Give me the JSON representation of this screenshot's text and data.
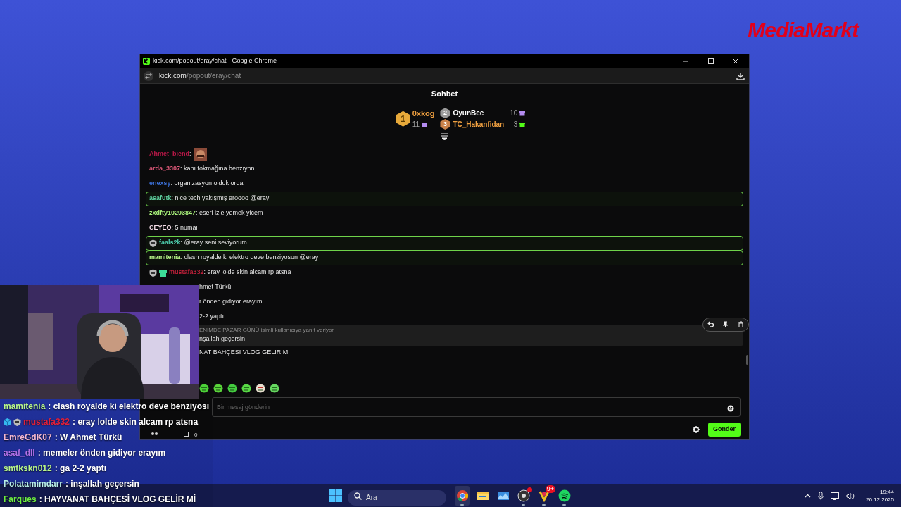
{
  "logo": {
    "text": "MediaMarkt"
  },
  "browser": {
    "title": "kick.com/popout/eray/chat - Google Chrome",
    "url_host": "kick.com",
    "url_path": "/popout/eray/chat"
  },
  "chat": {
    "title": "Sohbet",
    "leaderboard": [
      {
        "rank": "1",
        "name": "0xkog",
        "count": "11",
        "color": "#b48cf0"
      },
      {
        "rank": "2",
        "name": "OyunBee",
        "count": "10",
        "color": "#b48cf0"
      },
      {
        "rank": "3",
        "name": "TC_Hakanfidan",
        "count": "3",
        "color": "#53fc18"
      }
    ],
    "messages": [
      {
        "kind": "emote_message",
        "user": "Ahmet_biend",
        "color": "#c0184a",
        "text": ":",
        "highlighted": false
      },
      {
        "kind": "message",
        "user": "arda_3307",
        "color": "#e05a7a",
        "text": ": kapı tokmağına benzıyon",
        "highlighted": false
      },
      {
        "kind": "message",
        "user": "enexsy",
        "color": "#3b6fd6",
        "text": ": organizasyon olduk orda",
        "highlighted": false
      },
      {
        "kind": "message",
        "user": "asafutk",
        "color": "#5fd1a0",
        "text": ": nice tech yakışmış eroooo @eray",
        "highlighted": true
      },
      {
        "kind": "message",
        "user": "zxdfty10293847",
        "color": "#a8f07a",
        "text": ": eseri izle yemek yicem",
        "highlighted": false
      },
      {
        "kind": "message",
        "user": "CEYEO",
        "color": "#f5dce8",
        "text": ": 5 numai",
        "highlighted": false
      },
      {
        "kind": "message",
        "user": "faals2k",
        "color": "#4fd1b0",
        "text": ": @eray seni seviyorum",
        "highlighted": true,
        "badges": [
          {
            "kind": "shield"
          }
        ]
      },
      {
        "kind": "message",
        "user": "mamitenia",
        "color": "#b8f58a",
        "text": ": clash royalde ki elektro deve benziyosun @eray",
        "highlighted": true
      },
      {
        "kind": "message",
        "user": "mustafa332",
        "color": "#c0203a",
        "text": ": eray lolde skin alcam rp atsna",
        "highlighted": false,
        "badges": [
          {
            "kind": "shield"
          },
          {
            "kind": "gift"
          }
        ]
      },
      {
        "kind": "cut",
        "text": "hmet Türkü"
      },
      {
        "kind": "cut",
        "text": "r önden gidiyor erayım"
      },
      {
        "kind": "cut",
        "text": "2-2 yaptı"
      },
      {
        "kind": "reply",
        "reply_to": "ENİMDE PAZAR GÜNÜ isimli kullanıcıya yanıt veriyor",
        "text": "nşallah geçersin",
        "hovered": true
      },
      {
        "kind": "cut",
        "text": "NAT BAHÇESİ VLOG GELİR Mİ"
      },
      {
        "kind": "emotes"
      }
    ],
    "input": {
      "placeholder": "Bir mesaj gönderin"
    },
    "toolbar_count": "0",
    "send": "Gönder"
  },
  "stream_chat": [
    {
      "user": "mamitenia",
      "color": "#b8f58a",
      "text": ": clash royalde ki elektro deve benziyosı"
    },
    {
      "user": "mustafa332",
      "color": "#e0203a",
      "text": ": eray lolde skin alcam rp atsna",
      "badges": [
        {
          "kind": "cube"
        },
        {
          "kind": "shield"
        }
      ]
    },
    {
      "user": "EmreGdK07",
      "color": "#f5b8d0",
      "text": ": W Ahmet Türkü"
    },
    {
      "user": "asaf_dll",
      "color": "#b070e8",
      "text": ": memeler önden gidiyor erayım"
    },
    {
      "user": "smtkskn012",
      "color": "#b8f58a",
      "text": ": ga 2-2 yaptı"
    },
    {
      "user": "Polatamimdarr",
      "color": "#b8f0e8",
      "text": ": inşallah geçersin"
    },
    {
      "user": "Farques",
      "color": "#6ff040",
      "text": ": HAYVANAT BAHÇESİ VLOG GELİR Mİ"
    }
  ],
  "taskbar": {
    "search_placeholder": "Ara",
    "apps": [
      {
        "kind": "chrome",
        "running": true
      },
      {
        "kind": "files",
        "running": false
      },
      {
        "kind": "monitor",
        "running": false
      },
      {
        "kind": "obs",
        "running": true,
        "alert": true
      },
      {
        "kind": "paint",
        "running": true,
        "badge": "9+"
      },
      {
        "kind": "spotify",
        "running": true
      }
    ],
    "time": "19:44",
    "date": "26.12.2025"
  }
}
